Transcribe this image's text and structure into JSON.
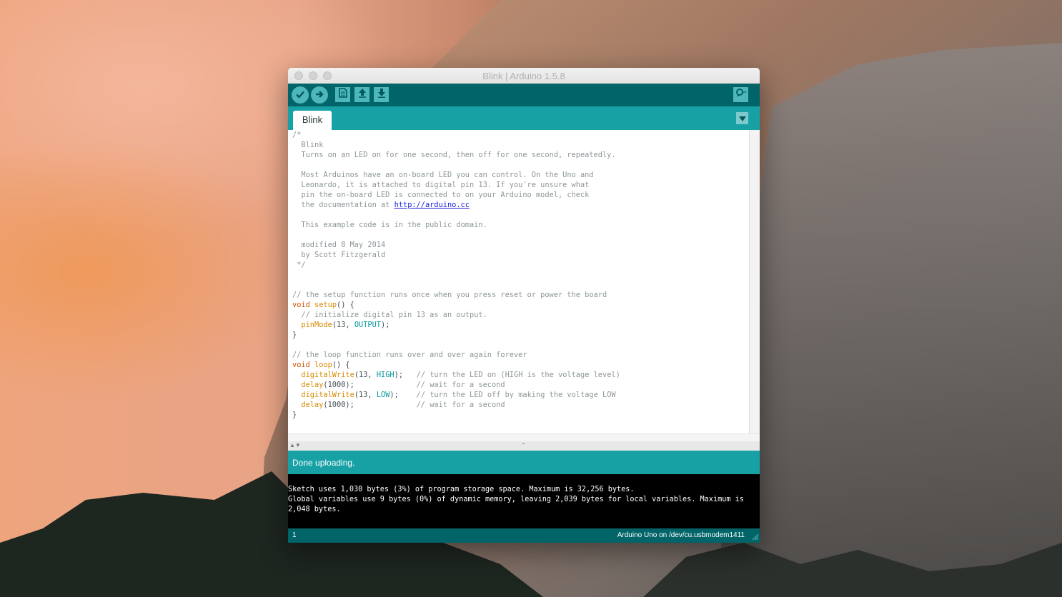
{
  "window": {
    "title": "Blink | Arduino 1.5.8"
  },
  "toolbar": {
    "verify_icon": "checkmark-icon",
    "upload_icon": "arrow-right-icon",
    "new_icon": "document-icon",
    "open_icon": "arrow-up-icon",
    "save_icon": "arrow-down-icon",
    "serial_monitor_icon": "magnifier-icon"
  },
  "tabs": [
    {
      "label": "Blink"
    }
  ],
  "editor": {
    "lines": [
      [
        [
          "cm",
          "/*"
        ]
      ],
      [
        [
          "cm",
          "  Blink"
        ]
      ],
      [
        [
          "cm",
          "  Turns on an LED on for one second, then off for one second, repeatedly."
        ]
      ],
      [
        [
          "cm",
          ""
        ]
      ],
      [
        [
          "cm",
          "  Most Arduinos have an on-board LED you can control. On the Uno and"
        ]
      ],
      [
        [
          "cm",
          "  Leonardo, it is attached to digital pin 13. If you're unsure what"
        ]
      ],
      [
        [
          "cm",
          "  pin the on-board LED is connected to on your Arduino model, check"
        ]
      ],
      [
        [
          "cm",
          "  the documentation at "
        ],
        [
          "lnk",
          "http://arduino.cc"
        ]
      ],
      [
        [
          "cm",
          ""
        ]
      ],
      [
        [
          "cm",
          "  This example code is in the public domain."
        ]
      ],
      [
        [
          "cm",
          ""
        ]
      ],
      [
        [
          "cm",
          "  modified 8 May 2014"
        ]
      ],
      [
        [
          "cm",
          "  by Scott Fitzgerald"
        ]
      ],
      [
        [
          "cm",
          " */"
        ]
      ],
      [
        [
          "txt",
          ""
        ]
      ],
      [
        [
          "txt",
          ""
        ]
      ],
      [
        [
          "cm",
          "// the setup function runs once when you press reset or power the board"
        ]
      ],
      [
        [
          "kw",
          "void"
        ],
        [
          "txt",
          " "
        ],
        [
          "fn",
          "setup"
        ],
        [
          "txt",
          "() {"
        ]
      ],
      [
        [
          "cm",
          "  // initialize digital pin 13 as an output."
        ]
      ],
      [
        [
          "txt",
          "  "
        ],
        [
          "fn",
          "pinMode"
        ],
        [
          "txt",
          "(13, "
        ],
        [
          "const",
          "OUTPUT"
        ],
        [
          "txt",
          ");"
        ]
      ],
      [
        [
          "txt",
          "}"
        ]
      ],
      [
        [
          "txt",
          ""
        ]
      ],
      [
        [
          "cm",
          "// the loop function runs over and over again forever"
        ]
      ],
      [
        [
          "kw",
          "void"
        ],
        [
          "txt",
          " "
        ],
        [
          "fn",
          "loop"
        ],
        [
          "txt",
          "() {"
        ]
      ],
      [
        [
          "txt",
          "  "
        ],
        [
          "fn",
          "digitalWrite"
        ],
        [
          "txt",
          "(13, "
        ],
        [
          "const",
          "HIGH"
        ],
        [
          "txt",
          ");   "
        ],
        [
          "cm",
          "// turn the LED on (HIGH is the voltage level)"
        ]
      ],
      [
        [
          "txt",
          "  "
        ],
        [
          "fn",
          "delay"
        ],
        [
          "txt",
          "(1000);              "
        ],
        [
          "cm",
          "// wait for a second"
        ]
      ],
      [
        [
          "txt",
          "  "
        ],
        [
          "fn",
          "digitalWrite"
        ],
        [
          "txt",
          "(13, "
        ],
        [
          "const",
          "LOW"
        ],
        [
          "txt",
          ");    "
        ],
        [
          "cm",
          "// turn the LED off by making the voltage LOW"
        ]
      ],
      [
        [
          "txt",
          "  "
        ],
        [
          "fn",
          "delay"
        ],
        [
          "txt",
          "(1000);              "
        ],
        [
          "cm",
          "// wait for a second"
        ]
      ],
      [
        [
          "txt",
          "}"
        ]
      ]
    ]
  },
  "status": {
    "message": "Done uploading."
  },
  "console": {
    "output": "Sketch uses 1,030 bytes (3%) of program storage space. Maximum is 32,256 bytes.\nGlobal variables use 9 bytes (0%) of dynamic memory, leaving 2,039 bytes for local variables. Maximum is\n2,048 bytes."
  },
  "footer": {
    "line_number": "1",
    "board": "Arduino Uno on /dev/cu.usbmodem1411"
  },
  "colors": {
    "toolbar": "#006468",
    "tabbar": "#17a1a5",
    "button": "#4db7bb"
  }
}
